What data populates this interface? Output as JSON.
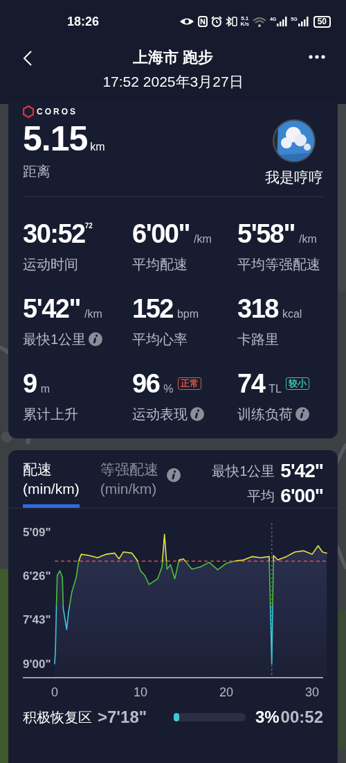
{
  "status_bar": {
    "time": "18:26",
    "net_speed": "5.1",
    "net_unit": "K/s",
    "signal_labels": [
      "4G",
      "5G"
    ],
    "battery": "50"
  },
  "header": {
    "title": "上海市 跑步",
    "subtitle": "17:52 2025年3月27日"
  },
  "summary_card": {
    "brand": "COROS",
    "distance": {
      "value": "5.15",
      "unit": "km",
      "label": "距离"
    },
    "user": {
      "name": "我是哼哼"
    },
    "metrics": [
      {
        "value": "30:52",
        "sup": "72",
        "label": "运动时间",
        "info": false
      },
      {
        "value": "6'00\"",
        "unit": "/km",
        "label": "平均配速",
        "info": false
      },
      {
        "value": "5'58\"",
        "unit": "/km",
        "label": "平均等强配速",
        "info": false
      },
      {
        "value": "5'42\"",
        "unit": "/km",
        "label": "最快1公里",
        "info": true
      },
      {
        "value": "152",
        "unit": "bpm",
        "label": "平均心率",
        "info": false
      },
      {
        "value": "318",
        "unit": "kcal",
        "label": "卡路里",
        "info": false
      },
      {
        "value": "9",
        "unit": "m",
        "label": "累计上升",
        "info": false
      },
      {
        "value": "96",
        "unit": "%",
        "badge": {
          "text": "正常",
          "color": "#e0553a"
        },
        "label": "运动表现",
        "info": true
      },
      {
        "value": "74",
        "unit": "TL",
        "badge": {
          "text": "较小",
          "color": "#3cc0b0"
        },
        "label": "训练负荷",
        "info": true
      }
    ]
  },
  "pace_card": {
    "tabs": [
      {
        "label": "配速",
        "sub": "(min/km)",
        "selected": true
      },
      {
        "label": "等强配速",
        "sub": "(min/km)",
        "selected": false
      }
    ],
    "stats": [
      {
        "label": "最快1公里",
        "value": "5'42\""
      },
      {
        "label": "平均",
        "value": "6'00\""
      }
    ],
    "pace_chart": {
      "y_labels": [
        "5'09\"",
        "6'26\"",
        "7'43\"",
        "9'00\""
      ],
      "x_labels": [
        "0",
        "10",
        "20",
        "30"
      ]
    },
    "zones": [
      {
        "name": "积极恢复区",
        "range": ">7'18\"",
        "level": 0.03,
        "percent": "3%",
        "time": "00:52"
      }
    ]
  }
}
